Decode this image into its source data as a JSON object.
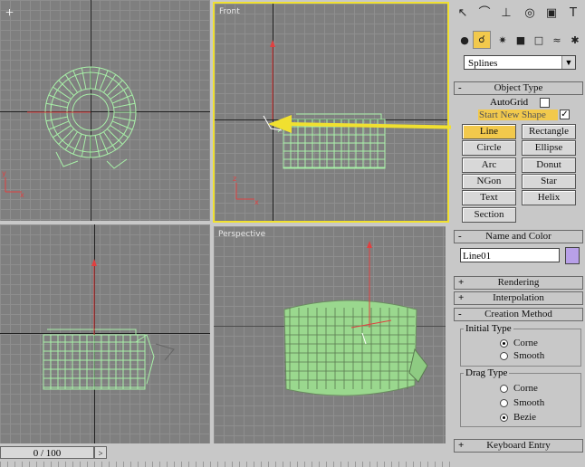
{
  "viewports": {
    "top": {
      "label": ""
    },
    "front": {
      "label": "Front"
    },
    "left": {
      "label": ""
    },
    "perspective": {
      "label": "Perspective"
    }
  },
  "panel": {
    "toolbar_icons": [
      "pointer-icon",
      "curve-icon",
      "hierarchy-icon",
      "motion-icon",
      "display-icon",
      "utilities-icon"
    ],
    "subtoolbar_icons": [
      "geometry-icon",
      "shapes-icon",
      "lights-icon",
      "cameras-icon",
      "helpers-icon",
      "spacewarps-icon",
      "systems-icon"
    ],
    "category_select": "Splines",
    "object_type": {
      "header": "Object Type",
      "autogrid": "AutoGrid",
      "start_new_shape": "Start New Shape",
      "buttons": [
        "Line",
        "Rectangle",
        "Circle",
        "Ellipse",
        "Arc",
        "Donut",
        "NGon",
        "Star",
        "Text",
        "Helix",
        "Section"
      ],
      "active": "Line"
    },
    "name_color": {
      "header": "Name and Color",
      "name_value": "Line01",
      "swatch_color": "#b8a0e8"
    },
    "rendering": "Rendering",
    "interpolation": "Interpolation",
    "creation_method": {
      "header": "Creation Method",
      "initial_type": {
        "label": "Initial Type",
        "options": [
          "Corne",
          "Smooth"
        ],
        "selected": "Corne"
      },
      "drag_type": {
        "label": "Drag Type",
        "options": [
          "Corne",
          "Smooth",
          "Bezie"
        ],
        "selected": "Bezie"
      }
    },
    "keyboard_entry": "Keyboard Entry"
  },
  "timeline": {
    "frame": "0 / 100"
  },
  "colors": {
    "wire": "#a8f0a8",
    "active_border": "#f0e030",
    "arrow": "#f0e030"
  }
}
